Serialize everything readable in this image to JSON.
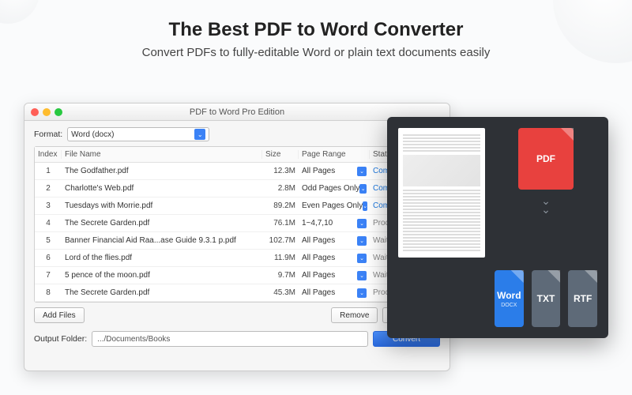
{
  "hero": {
    "title": "The Best PDF to Word Converter",
    "subtitle": "Convert PDFs to fully-editable Word or plain text documents easily"
  },
  "window": {
    "title": "PDF to Word Pro Edition",
    "format_label": "Format:",
    "format_value": "Word (docx)",
    "columns": {
      "index": "Index",
      "name": "File Name",
      "size": "Size",
      "range": "Page Range",
      "status": "Status"
    },
    "rows": [
      {
        "index": "1",
        "name": "The Godfather.pdf",
        "size": "12.3M",
        "range": "All Pages",
        "status": "Completed",
        "status_kind": "done"
      },
      {
        "index": "2",
        "name": "Charlotte's Web.pdf",
        "size": "2.8M",
        "range": "Odd Pages Only",
        "status": "Completed",
        "status_kind": "done"
      },
      {
        "index": "3",
        "name": "Tuesdays with Morrie.pdf",
        "size": "89.2M",
        "range": "Even Pages Only",
        "status": "Completed",
        "status_kind": "done"
      },
      {
        "index": "4",
        "name": "The Secrete Garden.pdf",
        "size": "76.1M",
        "range": "1~4,7,10",
        "status": "Processing...",
        "status_kind": "proc"
      },
      {
        "index": "5",
        "name": "Banner Financial Aid Raa...ase Guide 9.3.1 p.pdf",
        "size": "102.7M",
        "range": "All Pages",
        "status": "Waiting...",
        "status_kind": "wait"
      },
      {
        "index": "6",
        "name": "Lord of the flies.pdf",
        "size": "11.9M",
        "range": "All Pages",
        "status": "Waiting...",
        "status_kind": "wait"
      },
      {
        "index": "7",
        "name": "5 pence of the moon.pdf",
        "size": "9.7M",
        "range": "All Pages",
        "status": "Waiting...",
        "status_kind": "wait"
      },
      {
        "index": "8",
        "name": "The Secrete Garden.pdf",
        "size": "45.3M",
        "range": "All Pages",
        "status": "Processing",
        "status_kind": "proc"
      }
    ],
    "add_files": "Add Files",
    "remove": "Remove",
    "remove_all": "Remove All",
    "output_label": "Output Folder:",
    "output_path": ".../Documents/Books",
    "convert": "Convert"
  },
  "card": {
    "pdf": "PDF",
    "word": "Word",
    "word_sub": "DOCX",
    "txt": "TXT",
    "rtf": "RTF"
  }
}
